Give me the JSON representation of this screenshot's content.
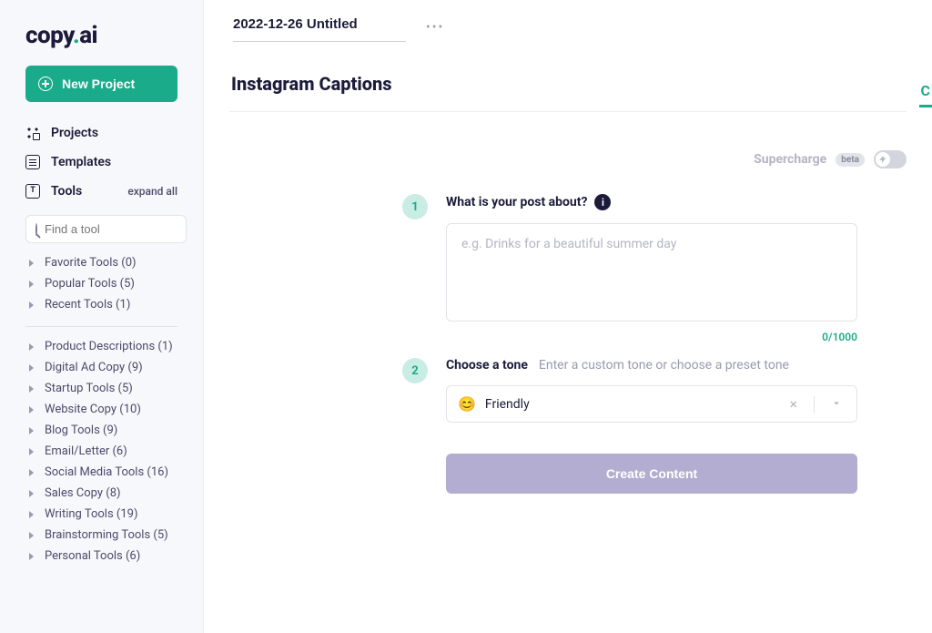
{
  "brand": {
    "name": "copy",
    "suffix": "ai"
  },
  "sidebar": {
    "new_project_label": "New Project",
    "nav": {
      "projects": "Projects",
      "templates": "Templates",
      "tools": "Tools",
      "expand_all": "expand all"
    },
    "search_placeholder": "Find a tool",
    "pinned": [
      {
        "label": "Favorite Tools (0)"
      },
      {
        "label": "Popular Tools (5)"
      },
      {
        "label": "Recent Tools (1)"
      }
    ],
    "categories": [
      {
        "label": "Product Descriptions (1)"
      },
      {
        "label": "Digital Ad Copy (9)"
      },
      {
        "label": "Startup Tools (5)"
      },
      {
        "label": "Website Copy (10)"
      },
      {
        "label": "Blog Tools (9)"
      },
      {
        "label": "Email/Letter (6)"
      },
      {
        "label": "Social Media Tools (16)"
      },
      {
        "label": "Sales Copy (8)"
      },
      {
        "label": "Writing Tools (19)"
      },
      {
        "label": "Brainstorming Tools (5)"
      },
      {
        "label": "Personal Tools (6)"
      }
    ]
  },
  "header": {
    "project_title": "2022-12-26 Untitled",
    "page_title": "Instagram Captions"
  },
  "supercharge": {
    "label": "Supercharge",
    "badge": "beta"
  },
  "form": {
    "step1": {
      "num": "1",
      "label": "What is your post about?",
      "placeholder": "e.g. Drinks for a beautiful summer day",
      "counter": "0/1000"
    },
    "step2": {
      "num": "2",
      "label": "Choose a tone",
      "hint": "Enter a custom tone or choose a preset tone",
      "value": "Friendly",
      "emoji": "😊"
    },
    "submit_label": "Create Content"
  }
}
